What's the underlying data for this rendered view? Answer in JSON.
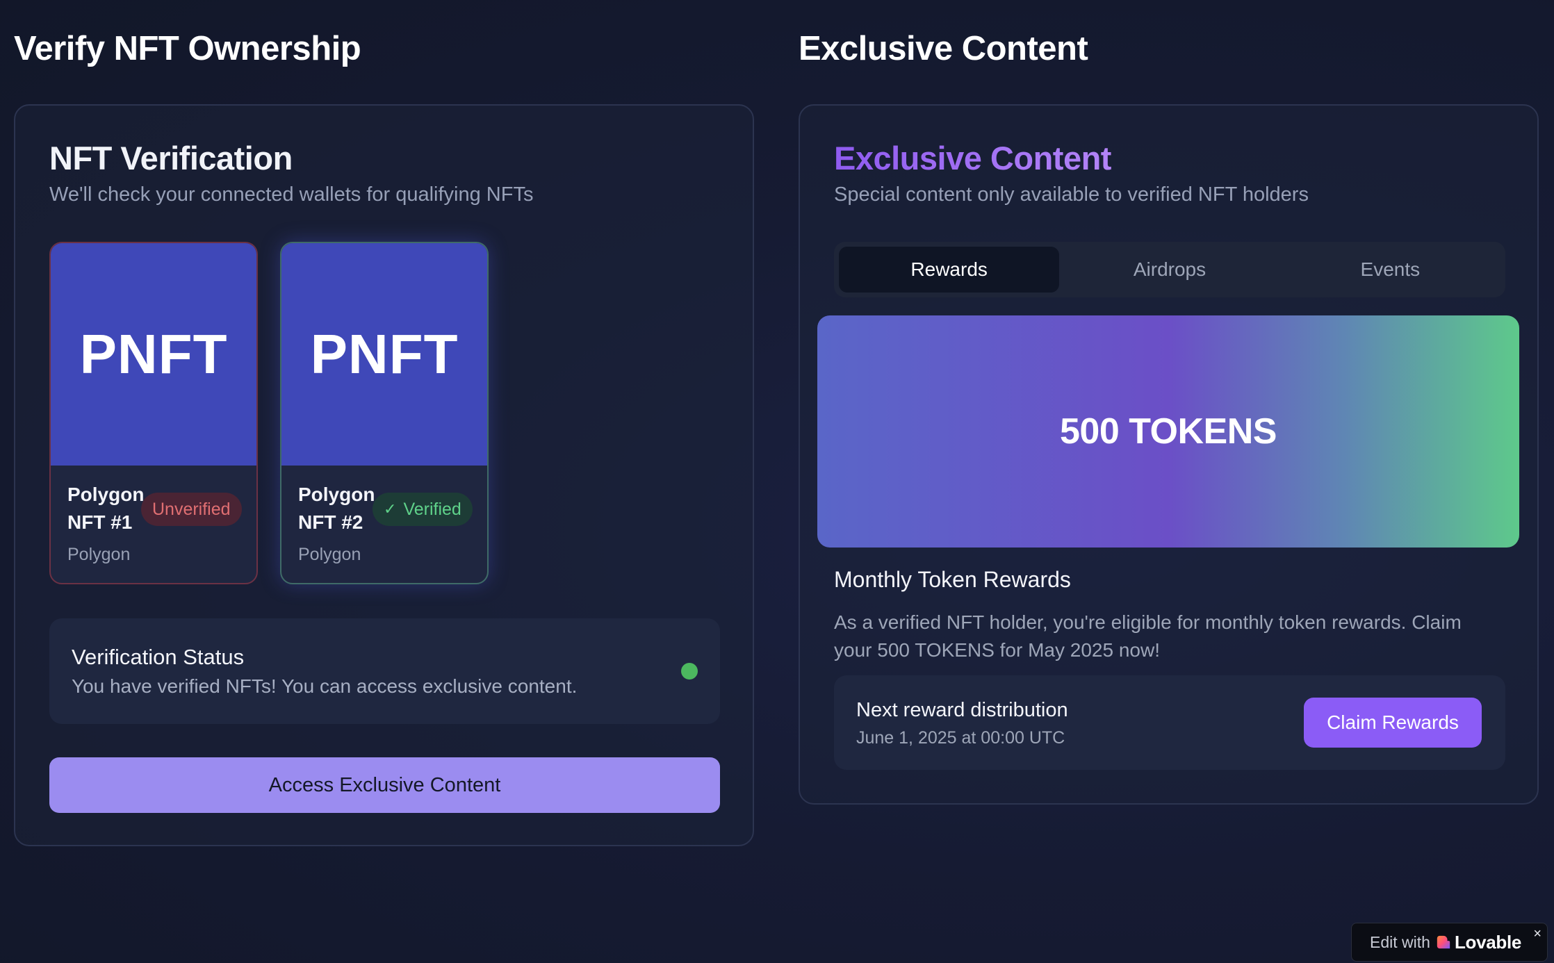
{
  "left_column": {
    "heading": "Verify NFT Ownership",
    "panel": {
      "title": "NFT Verification",
      "subtitle": "We'll check your connected wallets for qualifying NFTs",
      "nfts": [
        {
          "art_text": "PNFT",
          "name": "Polygon NFT #1",
          "chain": "Polygon",
          "status": "Unverified"
        },
        {
          "art_text": "PNFT",
          "name": "Polygon NFT #2",
          "chain": "Polygon",
          "status": "Verified"
        }
      ],
      "status_box": {
        "title": "Verification Status",
        "message": "You have verified NFTs! You can access exclusive content.",
        "dot_color": "#4cb85f"
      },
      "access_button": "Access Exclusive Content"
    }
  },
  "right_column": {
    "heading": "Exclusive Content",
    "panel": {
      "title": "Exclusive Content",
      "subtitle": "Special content only available to verified NFT holders",
      "tabs": [
        {
          "label": "Rewards",
          "active": true
        },
        {
          "label": "Airdrops",
          "active": false
        },
        {
          "label": "Events",
          "active": false
        }
      ],
      "reward_banner": "500 TOKENS",
      "rewards_heading": "Monthly Token Rewards",
      "rewards_description": "As a verified NFT holder, you're eligible for monthly token rewards. Claim your 500 TOKENS for May 2025 now!",
      "distribution": {
        "title": "Next reward distribution",
        "date": "June 1, 2025 at 00:00 UTC",
        "claim_button": "Claim Rewards"
      }
    }
  },
  "lovable_badge": {
    "edit_text": "Edit with",
    "brand": "Lovable",
    "close": "×"
  },
  "colors": {
    "accent_purple": "#8b5cf6",
    "access_button": "#9b8cf0",
    "nft_art": "#3f48b8",
    "verified_green": "#5fd28a",
    "unverified_red": "#e06f72"
  }
}
